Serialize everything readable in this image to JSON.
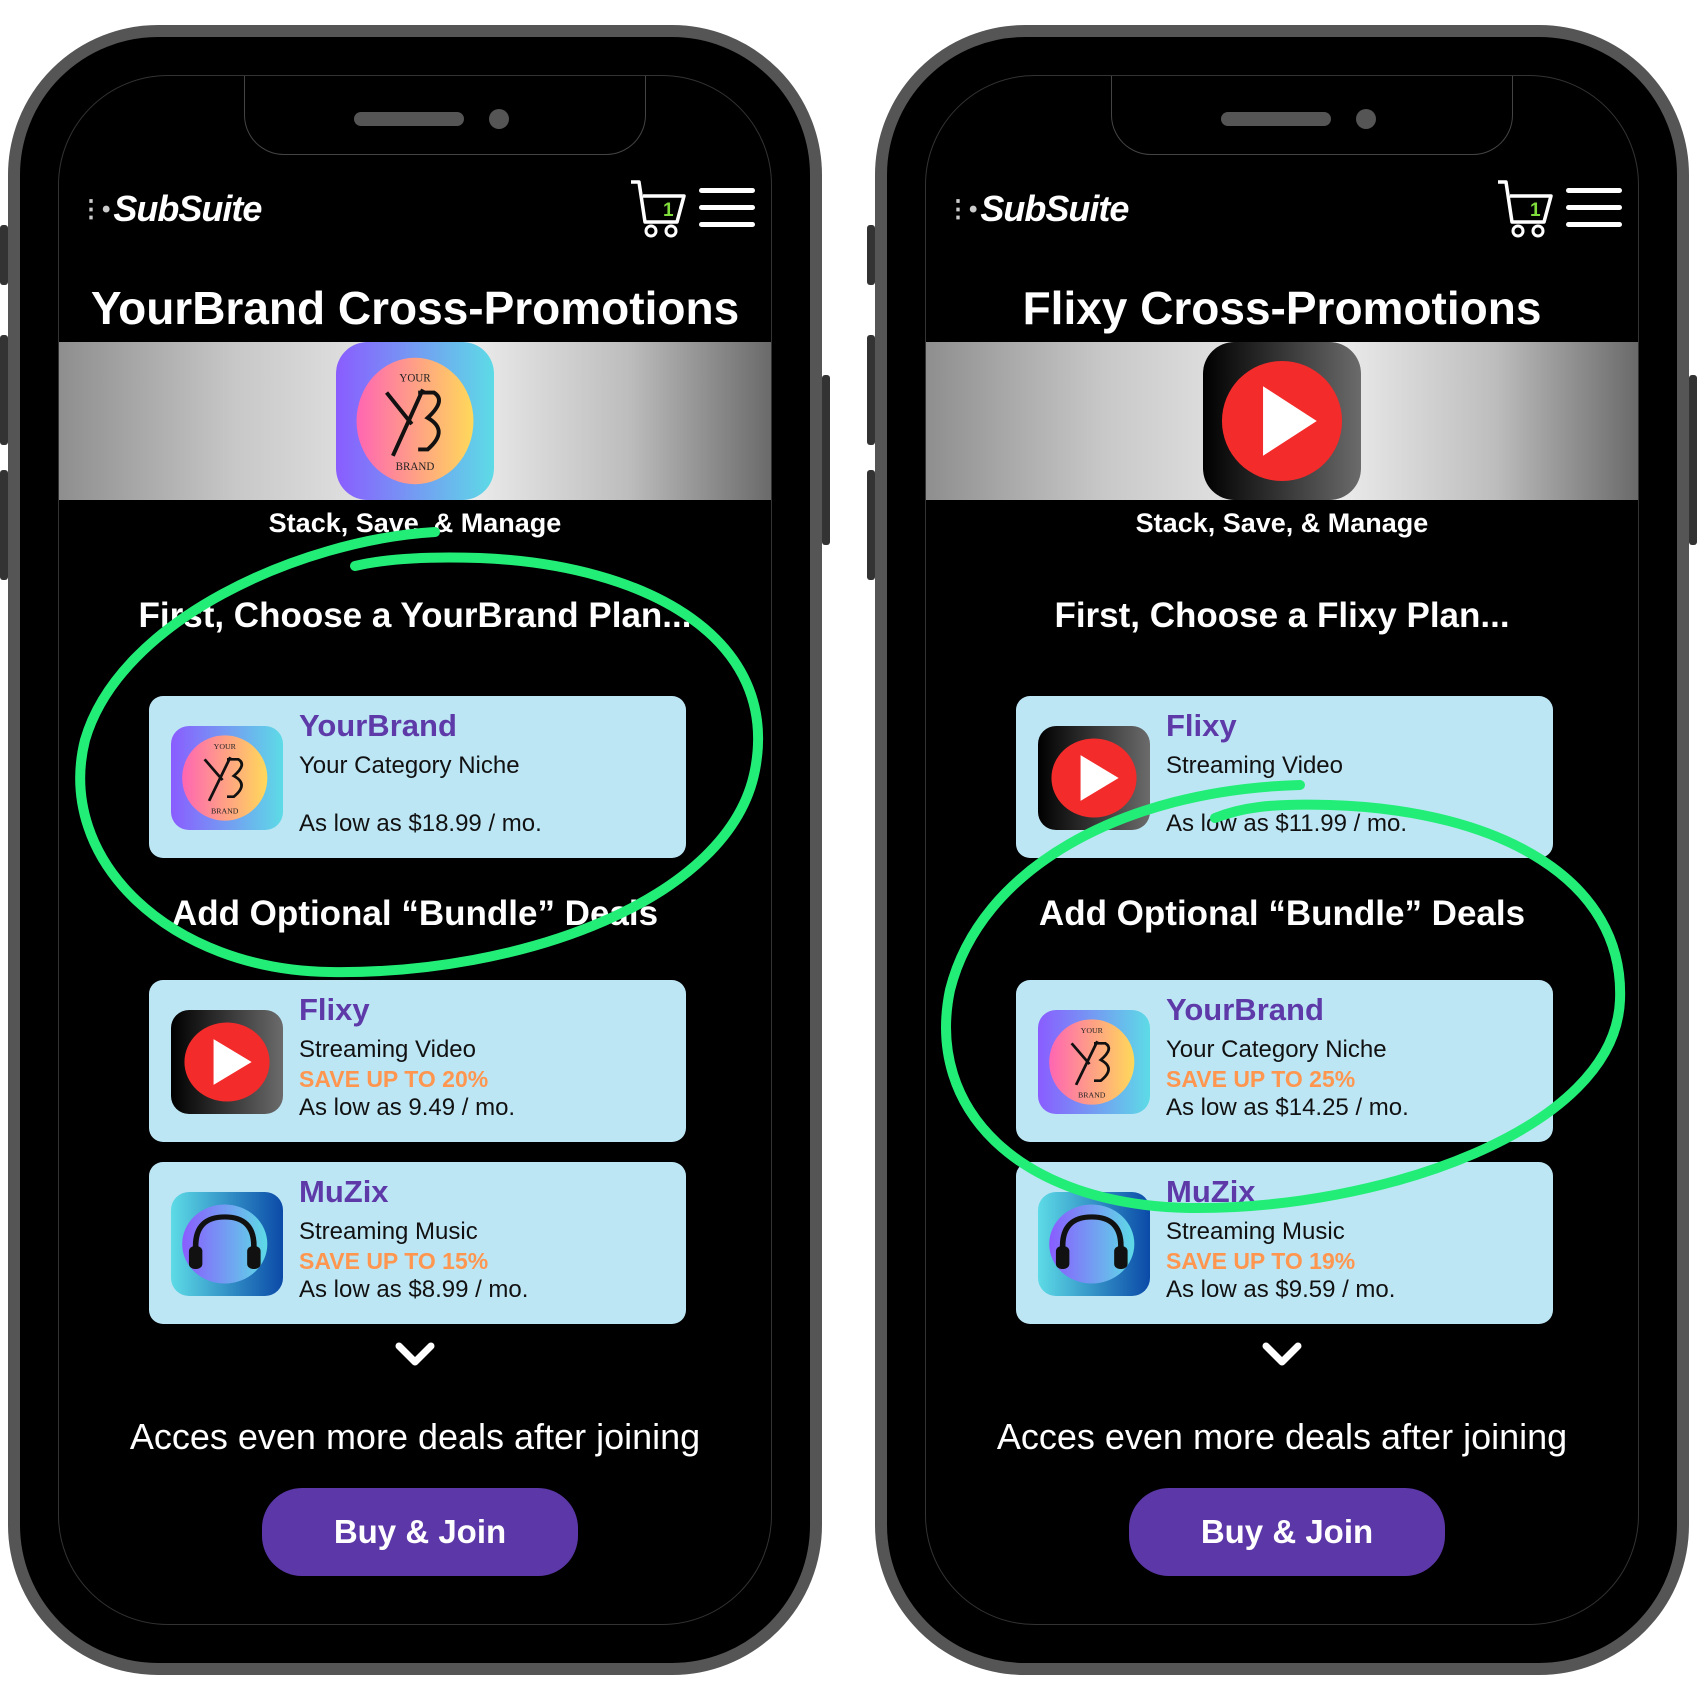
{
  "colors": {
    "accent_purple": "#5c37a8",
    "card_bg": "#bde6f5",
    "save_orange": "#ff9650",
    "annotation_green": "#22ee77",
    "cart_badge_green": "#7fdc3a"
  },
  "phones": [
    {
      "header": {
        "logo": "SubSuite",
        "cart_count": "1",
        "cart_icon": "shopping-cart-icon",
        "menu_icon": "hamburger-menu-icon"
      },
      "title": "YourBrand Cross-Promotions",
      "banner_brand": "YourBrand",
      "tagline": "Stack, Save, & Manage",
      "plan_heading": "First, Choose a YourBrand Plan...",
      "plan": {
        "name": "YourBrand",
        "category": "Your Category Niche",
        "save": "",
        "price": "As low as $18.99 / mo.",
        "icon": "yourbrand-logo-icon"
      },
      "bundle_heading": "Add Optional “Bundle” Deals",
      "bundles": [
        {
          "name": "Flixy",
          "category": "Streaming Video",
          "save": "SAVE UP TO 20%",
          "price": "As low as 9.49 / mo.",
          "icon": "flixy-play-icon"
        },
        {
          "name": "MuZix",
          "category": "Streaming Music",
          "save": "SAVE UP TO 15%",
          "price": "As low as $8.99 / mo.",
          "icon": "muzix-headphones-icon"
        }
      ],
      "more_text": "Acces even more deals after joining",
      "buy_label": "Buy & Join"
    },
    {
      "header": {
        "logo": "SubSuite",
        "cart_count": "1",
        "cart_icon": "shopping-cart-icon",
        "menu_icon": "hamburger-menu-icon"
      },
      "title": "Flixy Cross-Promotions",
      "banner_brand": "Flixy",
      "tagline": "Stack, Save, & Manage",
      "plan_heading": "First, Choose a Flixy Plan...",
      "plan": {
        "name": "Flixy",
        "category": "Streaming Video",
        "save": "",
        "price": "As low as $11.99 / mo.",
        "icon": "flixy-play-icon"
      },
      "bundle_heading": "Add Optional “Bundle” Deals",
      "bundles": [
        {
          "name": "YourBrand",
          "category": "Your Category Niche",
          "save": "SAVE UP TO 25%",
          "price": "As low as $14.25 / mo.",
          "icon": "yourbrand-logo-icon"
        },
        {
          "name": "MuZix",
          "category": "Streaming Music",
          "save": "SAVE UP TO 19%",
          "price": "As low as $9.59 / mo.",
          "icon": "muzix-headphones-icon"
        }
      ],
      "more_text": "Acces even more deals after joining",
      "buy_label": "Buy & Join"
    }
  ],
  "yb_logo": {
    "top": "YOUR",
    "bottom": "BRAND",
    "mark": "YB"
  }
}
